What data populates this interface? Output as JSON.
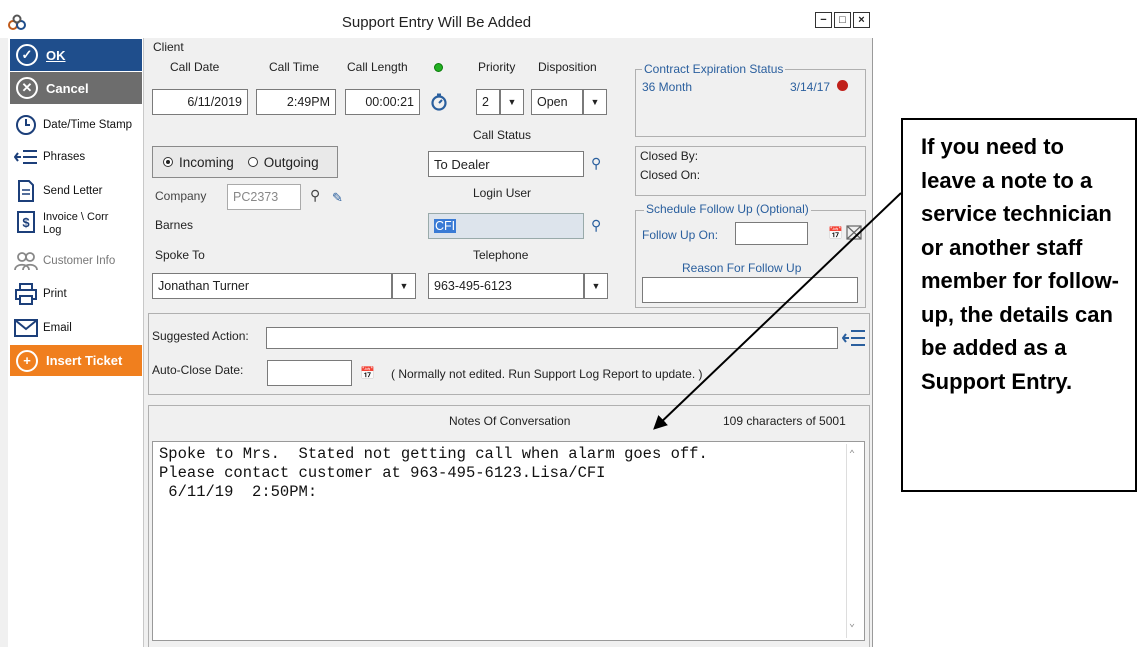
{
  "window": {
    "title": "Support Entry Will Be  Added",
    "controls": {
      "minimize": "−",
      "maximize": "□",
      "close": "×"
    }
  },
  "sidebar": {
    "ok": "OK",
    "cancel": "Cancel",
    "date_time_stamp": "Date/Time Stamp",
    "phrases": "Phrases",
    "send_letter": "Send Letter",
    "invoice_corr_log": "Invoice \\ Corr\nLog",
    "customer_info": "Customer Info",
    "print": "Print",
    "email": "Email",
    "insert_ticket": "Insert Ticket"
  },
  "form": {
    "client_label": "Client",
    "call_date_label": "Call Date",
    "call_date": "6/11/2019",
    "call_time_label": "Call Time",
    "call_time": "2:49PM",
    "call_length_label": "Call Length",
    "call_length": "00:00:21",
    "priority_label": "Priority",
    "priority": "2",
    "disposition_label": "Disposition",
    "disposition": "Open",
    "incoming_label": "Incoming",
    "outgoing_label": "Outgoing",
    "call_status_label": "Call Status",
    "call_status": "To Dealer",
    "company_label": "Company",
    "company_placeholder": "PC2373",
    "login_user_label": "Login User",
    "login_user": "CFI",
    "client_name": "Barnes",
    "spoke_to_label": "Spoke To",
    "spoke_to": "Jonathan Turner",
    "telephone_label": "Telephone",
    "telephone": "963-495-6123"
  },
  "contract": {
    "legend": "Contract Expiration Status",
    "term": "36 Month",
    "expires": "3/14/17"
  },
  "closed": {
    "closed_by_label": "Closed By:",
    "closed_on_label": "Closed On:"
  },
  "follow_up": {
    "legend": "Schedule Follow Up (Optional)",
    "follow_up_on_label": "Follow Up On:",
    "reason_label": "Reason For Follow Up"
  },
  "action": {
    "suggested_action_label": "Suggested Action:",
    "auto_close_label": "Auto-Close Date:",
    "auto_close_note": "( Normally not edited. Run Support Log Report to update. )"
  },
  "notes": {
    "header": "Notes Of Conversation",
    "char_count": "109 characters of 5001",
    "line1": "Spoke to Mrs.  Stated not getting call when alarm goes off.",
    "line2": "Please contact customer at 963-495-6123.Lisa/CFI",
    "line3": " 6/11/19  2:50PM:"
  },
  "callout": {
    "text": "If you need to leave a note to a service technician or another staff member for follow-up, the details can be added as a Support Entry."
  },
  "colors": {
    "ok_bg": "#1f4e8c",
    "cancel_bg": "#6d6d6d",
    "insert_ticket_bg": "#f07f1e",
    "status_green": "#22b022",
    "expired_red": "#c0201a",
    "link_blue": "#2a5f9e"
  },
  "icons": {
    "ok": "check-circle-icon",
    "cancel": "x-circle-icon",
    "date_time_stamp": "clock-icon",
    "phrases": "list-arrow-icon",
    "send_letter": "document-icon",
    "invoice": "dollar-document-icon",
    "customer_info": "users-icon",
    "print": "printer-icon",
    "email": "envelope-icon",
    "insert_ticket": "plus-circle-icon"
  }
}
